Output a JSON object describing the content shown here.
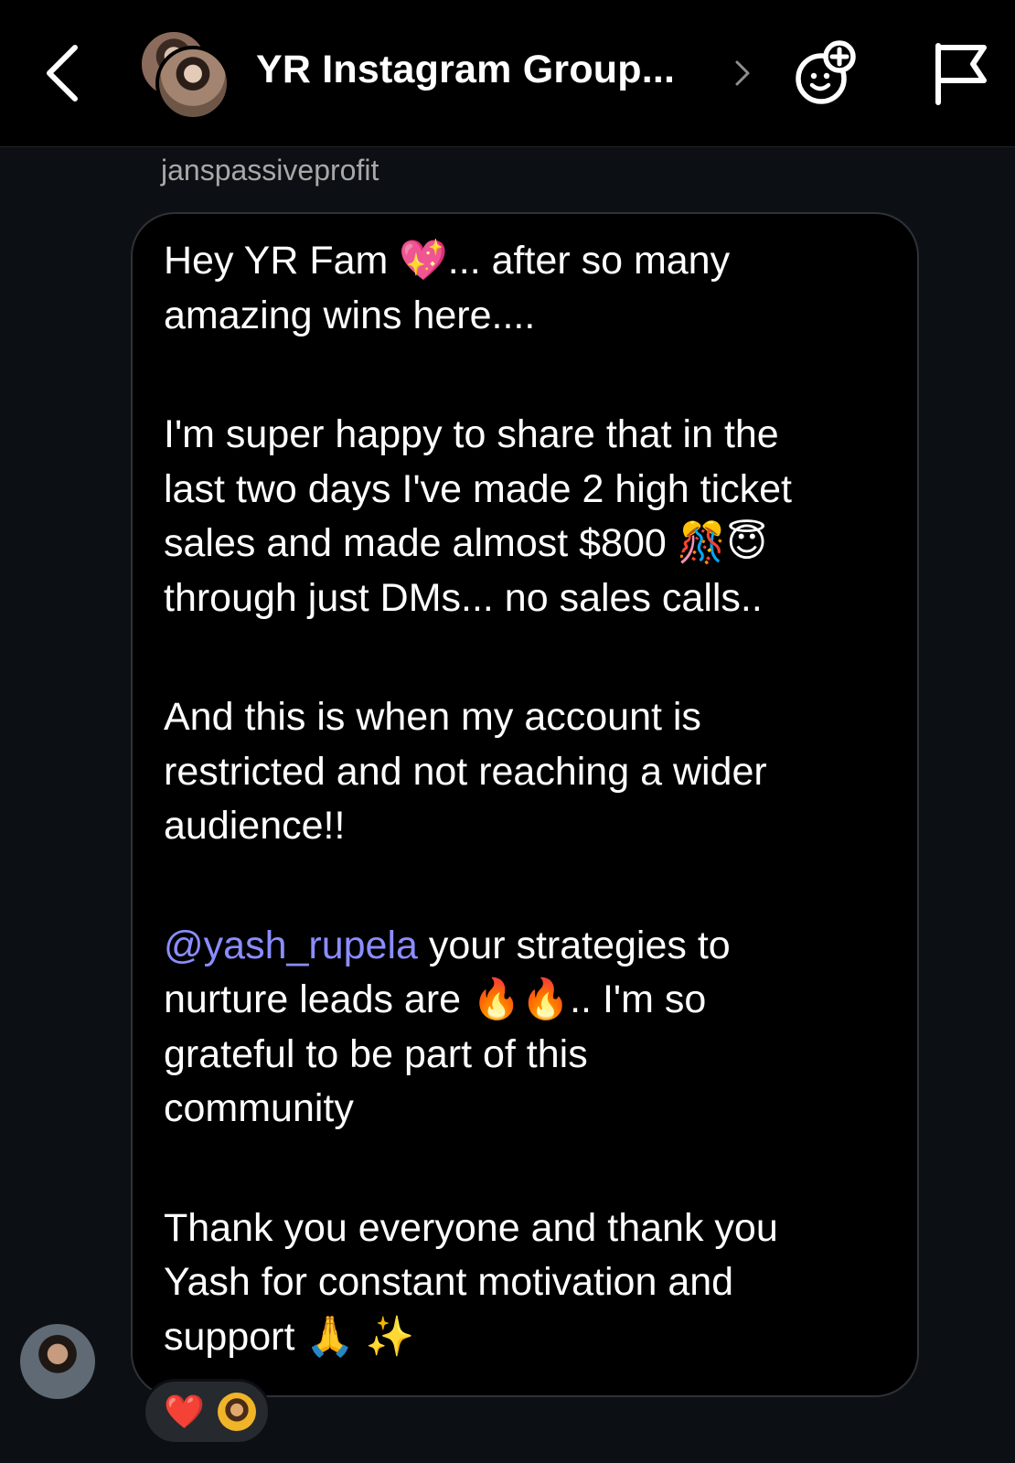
{
  "header": {
    "title": "YR Instagram Group...",
    "icons": {
      "back": "chevron-left-icon",
      "title_chevron": "chevron-right-icon",
      "effects": "face-plus-icon",
      "report": "flag-icon"
    }
  },
  "message": {
    "sender": "janspassiveprofit",
    "paragraphs": [
      {
        "text": "Hey YR Fam 💖... after so many\namazing wins here...."
      },
      {
        "text": "I'm super happy to share that in the\nlast two days I've made 2 high ticket\nsales and made almost $800 🎊😇\nthrough just DMs... no sales calls.."
      },
      {
        "text": "And this is when my account is\nrestricted and not reaching a wider\naudience!!"
      },
      {
        "mention": "@yash_rupela",
        "text": " your strategies to\nnurture leads are 🔥🔥.. I'm so\ngrateful to be part of this\ncommunity"
      },
      {
        "text": "Thank you everyone and thank you\nYash for constant motivation and\nsupport 🙏 ✨"
      }
    ]
  },
  "reactions": {
    "emoji": "❤️"
  },
  "colors": {
    "background": "#0c1014",
    "header": "#000000",
    "bubble": "#000000",
    "bubble_border": "#2e3236",
    "mention": "#8b8dff",
    "sender_name": "#a8a8a8",
    "reaction_pill": "#26292d"
  }
}
